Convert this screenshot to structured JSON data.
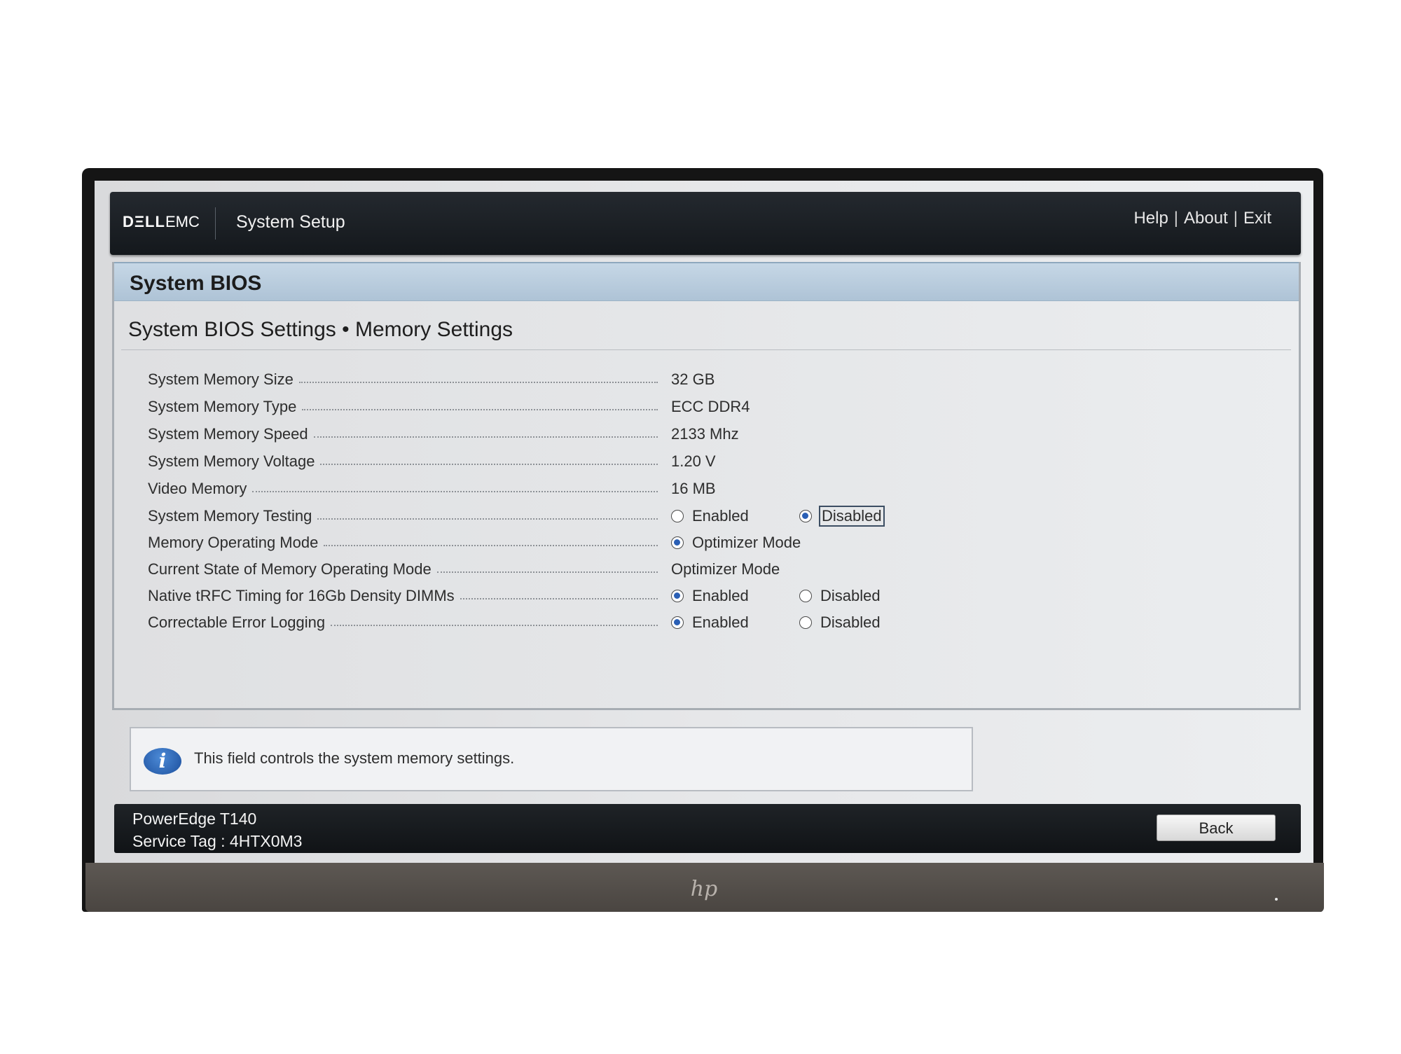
{
  "header": {
    "brand_dell": "DΞLL",
    "brand_emc": "EMC",
    "app_title": "System Setup",
    "links": [
      "Help",
      "About",
      "Exit"
    ],
    "separator": "|"
  },
  "panel": {
    "title": "System BIOS",
    "section": "System BIOS Settings • Memory Settings"
  },
  "settings": [
    {
      "label": "System Memory Size",
      "value": "32 GB"
    },
    {
      "label": "System Memory Type",
      "value": "ECC DDR4"
    },
    {
      "label": "System Memory Speed",
      "value": "2133 Mhz"
    },
    {
      "label": "System Memory Voltage",
      "value": "1.20 V"
    },
    {
      "label": "Video Memory",
      "value": "16 MB"
    },
    {
      "label": "System Memory Testing",
      "options": [
        "Enabled",
        "Disabled"
      ],
      "selected": "Disabled",
      "focused": "Disabled"
    },
    {
      "label": "Memory Operating Mode",
      "options": [
        "Optimizer Mode"
      ],
      "selected": "Optimizer Mode"
    },
    {
      "label": "Current State of Memory Operating Mode",
      "value": "Optimizer Mode"
    },
    {
      "label": "Native tRFC Timing for 16Gb Density DIMMs",
      "options": [
        "Enabled",
        "Disabled"
      ],
      "selected": "Enabled"
    },
    {
      "label": "Correctable Error Logging",
      "options": [
        "Enabled",
        "Disabled"
      ],
      "selected": "Enabled"
    }
  ],
  "info": {
    "icon": "info-icon",
    "text": "This field controls the system memory settings."
  },
  "footer": {
    "model": "PowerEdge T140",
    "service_tag": "Service Tag : 4HTX0M3",
    "back_label": "Back"
  },
  "bezel": {
    "logo": "hp"
  },
  "colors": {
    "header_bg": "#1a1e22",
    "panel_head_bg": "#bcd0e1",
    "radio_selected": "#2a5fb5"
  }
}
